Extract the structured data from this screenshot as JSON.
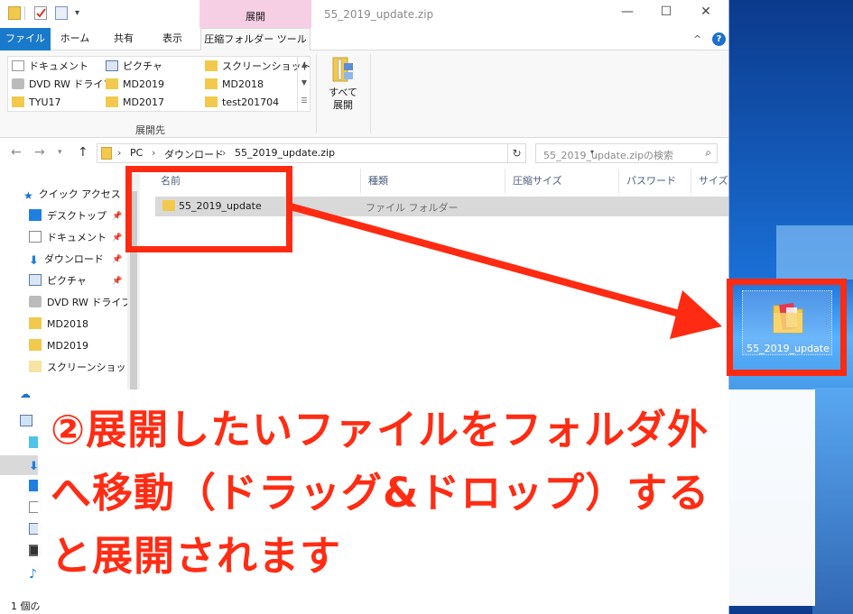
{
  "window": {
    "title": "55_2019_update.zip",
    "context_tab": "展開",
    "controls": {
      "minimize": "—",
      "maximize": "☐",
      "close": "✕"
    }
  },
  "ribbon_tabs": [
    "ファイル",
    "ホーム",
    "共有",
    "表示",
    "圧縮フォルダー ツール"
  ],
  "ribbon": {
    "destinations": [
      "ドキュメント",
      "ピクチャ",
      "スクリーンショット",
      "DVD RW ドライブ",
      "MD2019",
      "MD2018",
      "TYU17",
      "MD2017",
      "test201704"
    ],
    "group_label": "展開先",
    "extract_all_label_1": "すべて",
    "extract_all_label_2": "展開"
  },
  "address": {
    "crumbs": [
      "PC",
      "ダウンロード",
      "55_2019_update.zip"
    ],
    "search_placeholder": "55_2019_update.zipの検索"
  },
  "nav": {
    "quick_access": "クイック アクセス",
    "items": [
      "デスクトップ",
      "ドキュメント",
      "ダウンロード",
      "ピクチャ",
      "DVD RW ドライブ (",
      "MD2018",
      "MD2019",
      "スクリーンショット"
    ]
  },
  "columns": [
    "名前",
    "種類",
    "圧縮サイズ",
    "パスワード保...",
    "サイズ"
  ],
  "file": {
    "name": "55_2019_update",
    "type": "ファイル フォルダー"
  },
  "status": {
    "text": "1 個の"
  },
  "desktop_icon": {
    "label": "55_2019_update"
  },
  "caption": {
    "line1": "②展開したいファイルをフォルダ外",
    "line2": "へ移動（ドラッグ&ドロップ）する",
    "line3": "と展開されます"
  },
  "colors": {
    "accent": "#1979ca",
    "annotation": "#ff2a12",
    "context_tab": "#f6cfe4"
  }
}
